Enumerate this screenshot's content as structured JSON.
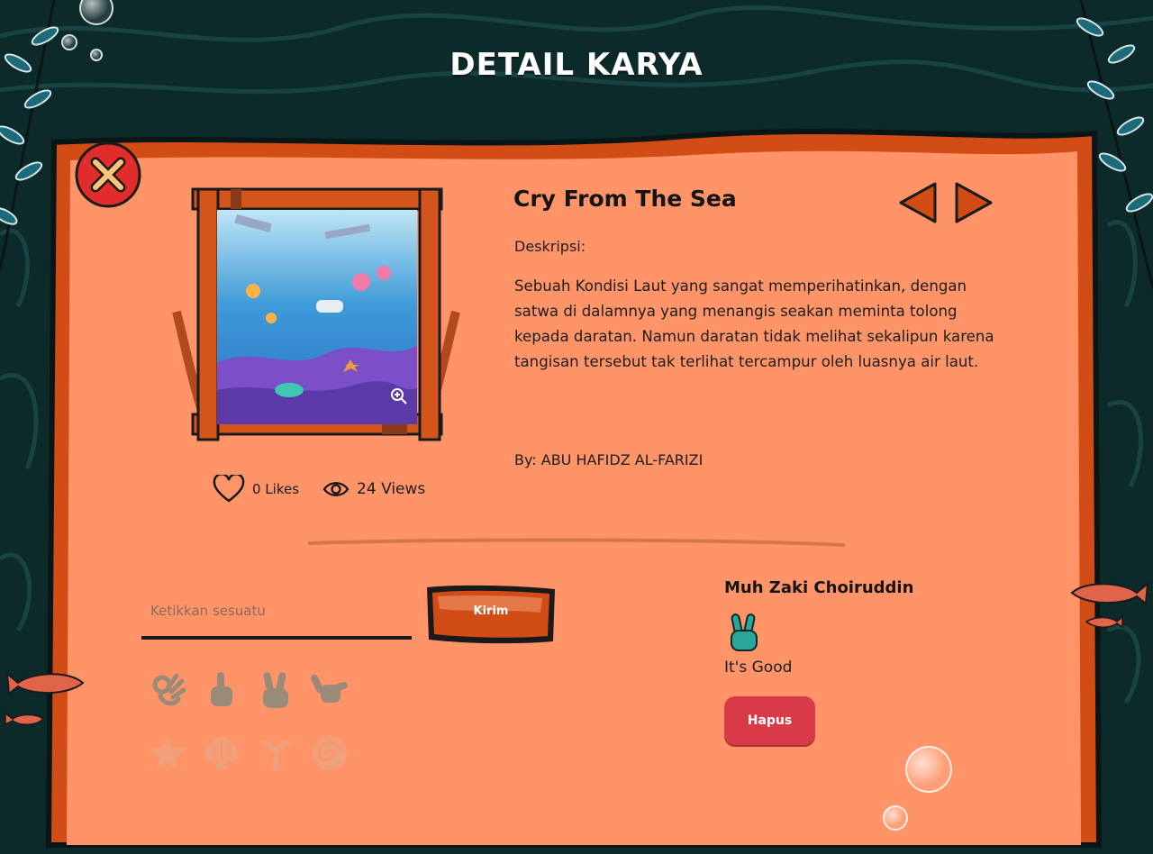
{
  "page": {
    "title": "DETAIL KARYA"
  },
  "artwork": {
    "title": "Cry From The Sea",
    "description_label": "Deskripsi:",
    "description": "Sebuah Kondisi Laut yang sangat memperihatinkan, dengan satwa di dalamnya yang menangis seakan meminta tolong kepada daratan. Namun daratan tidak melihat sekalipun karena tangisan tersebut tak terlihat tercampur oleh luasnya air laut.",
    "author": "By: ABU HAFIDZ AL-FARIZI",
    "likes": "0 Likes",
    "views": "24 Views"
  },
  "comment_form": {
    "placeholder": "Ketikkan sesuatu",
    "send_label": "Kirim",
    "emojis": [
      "ok-hand-icon",
      "pointing-up-icon",
      "peace-hand-icon",
      "shaka-hand-icon",
      "starfish-icon",
      "shell-icon",
      "whale-tail-icon",
      "nautilus-icon"
    ]
  },
  "comments": [
    {
      "name": "Muh Zaki Choiruddin",
      "emoji": "peace-hand-icon",
      "text": "It's Good",
      "delete_label": "Hapus"
    }
  ],
  "colors": {
    "board": "#ff9468",
    "board_border": "#d24d16",
    "sea": "#0c2a2a",
    "delete": "#d93a48",
    "emoji_fill": "#9a8a78",
    "accent_teal": "#2aa79a"
  }
}
